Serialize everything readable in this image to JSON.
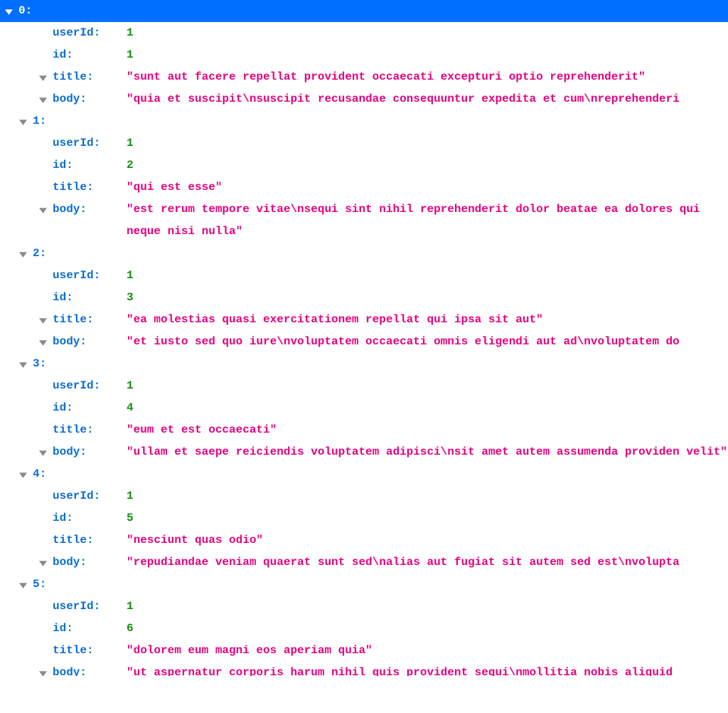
{
  "items": [
    {
      "index": "0",
      "selected": true,
      "userId": 1,
      "id": 1,
      "title": "sunt aut facere repellat provident occaecati excepturi optio reprehenderit",
      "title_expandable": true,
      "title_nowrap": true,
      "body": "quia et suscipit\\nsuscipit recusandae consequuntur expedita et cum\\nreprehenderi",
      "body_nowrap": true
    },
    {
      "index": "1",
      "selected": false,
      "userId": 1,
      "id": 2,
      "title": "qui est esse",
      "title_expandable": false,
      "title_nowrap": false,
      "body": "est rerum tempore vitae\\nsequi sint nihil reprehenderit dolor beatae ea dolores qui neque nisi nulla",
      "body_nowrap": false
    },
    {
      "index": "2",
      "selected": false,
      "userId": 1,
      "id": 3,
      "title": "ea molestias quasi exercitationem repellat qui ipsa sit aut",
      "title_expandable": true,
      "title_nowrap": true,
      "body": "et iusto sed quo iure\\nvoluptatem occaecati omnis eligendi aut ad\\nvoluptatem do",
      "body_nowrap": true
    },
    {
      "index": "3",
      "selected": false,
      "userId": 1,
      "id": 4,
      "title": "eum et est occaecati",
      "title_expandable": false,
      "title_nowrap": false,
      "body": "ullam et saepe reiciendis voluptatem adipisci\\nsit amet autem assumenda providen velit",
      "body_nowrap": false
    },
    {
      "index": "4",
      "selected": false,
      "userId": 1,
      "id": 5,
      "title": "nesciunt quas odio",
      "title_expandable": false,
      "title_nowrap": false,
      "body": "repudiandae veniam quaerat sunt sed\\nalias aut fugiat sit autem sed est\\nvolupta",
      "body_nowrap": true
    },
    {
      "index": "5",
      "selected": false,
      "userId": 1,
      "id": 6,
      "title": "dolorem eum magni eos aperiam quia",
      "title_expandable": false,
      "title_nowrap": false,
      "body": "ut aspernatur corporis harum nihil quis provident sequi\\nmollitia nobis aliquid",
      "body_nowrap": true,
      "body_partial": true
    }
  ],
  "labels": {
    "userId": "userId:",
    "id": "id:",
    "title": "title:",
    "body": "body:"
  }
}
